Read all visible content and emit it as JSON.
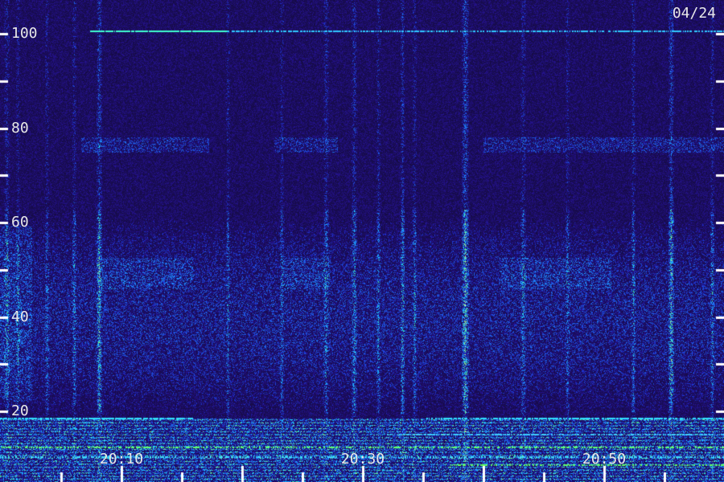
{
  "header": {
    "date": "04/24"
  },
  "chart_data": {
    "type": "heatmap",
    "title": "",
    "xlabel": "",
    "ylabel": "",
    "y_ticks": [
      "100",
      "80",
      "60",
      "40",
      "20"
    ],
    "y_tick_values": [
      100,
      80,
      60,
      40,
      20
    ],
    "ylim": [
      2,
      104
    ],
    "x_ticks": [
      "20:10",
      "20:30",
      "20:50"
    ],
    "x_tick_minutes": [
      10,
      30,
      50
    ],
    "xlim_minutes": [
      0,
      60
    ],
    "x_minor_tick_minutes": [
      5,
      10,
      15,
      20,
      25,
      30,
      35,
      40,
      45,
      50,
      55
    ],
    "y_minor_tick_values": [
      30,
      50,
      70,
      90
    ],
    "colors": {
      "background": "#15104a",
      "low": "#2a1a8a",
      "mid": "#2040e0",
      "high": "#30d0ff",
      "peak": "#60ff60",
      "tick": "#ffffff"
    }
  }
}
